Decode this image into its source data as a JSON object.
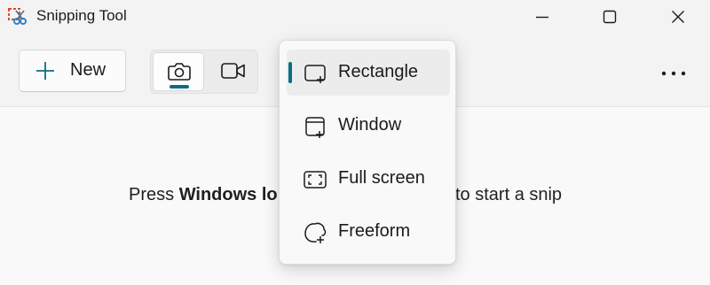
{
  "window": {
    "title": "Snipping Tool",
    "controls": {
      "minimize": "minimize-icon",
      "maximize": "maximize-icon",
      "close": "close-icon"
    }
  },
  "toolbar": {
    "new_label": "New",
    "modes": [
      {
        "name": "snip",
        "icon": "camera-icon",
        "selected": true
      },
      {
        "name": "record",
        "icon": "video-camera-icon",
        "selected": false
      }
    ],
    "more_icon": "more-icon"
  },
  "snip_menu": {
    "items": [
      {
        "label": "Rectangle",
        "icon": "rectangle-snip-icon",
        "selected": true
      },
      {
        "label": "Window",
        "icon": "window-snip-icon",
        "selected": false
      },
      {
        "label": "Full screen",
        "icon": "fullscreen-snip-icon",
        "selected": false
      },
      {
        "label": "Freeform",
        "icon": "freeform-snip-icon",
        "selected": false
      }
    ]
  },
  "content": {
    "hint_prefix": "Press ",
    "hint_bold_visible": "Windows lo",
    "hint_suffix_visible": "to start a snip"
  },
  "colors": {
    "accent": "#0b6e80",
    "background": "#f3f3f3",
    "content_background": "#f9f9f9"
  }
}
